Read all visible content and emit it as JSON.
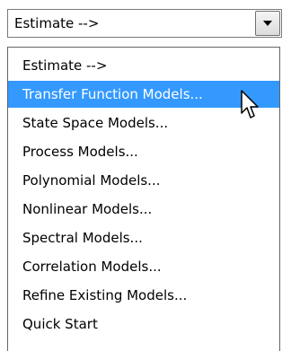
{
  "combo": {
    "value": "Estimate -->",
    "button_icon": "chevron-down-icon"
  },
  "dropdown": {
    "selected_index": 1,
    "highlight_color": "#3399ff",
    "items": [
      {
        "label": "Estimate -->"
      },
      {
        "label": "Transfer Function Models..."
      },
      {
        "label": "State Space Models..."
      },
      {
        "label": "Process Models..."
      },
      {
        "label": "Polynomial Models..."
      },
      {
        "label": "Nonlinear Models..."
      },
      {
        "label": "Spectral Models..."
      },
      {
        "label": "Correlation Models..."
      },
      {
        "label": "Refine Existing Models..."
      },
      {
        "label": "Quick Start"
      }
    ]
  },
  "cursor": {
    "icon": "mouse-pointer-icon"
  }
}
